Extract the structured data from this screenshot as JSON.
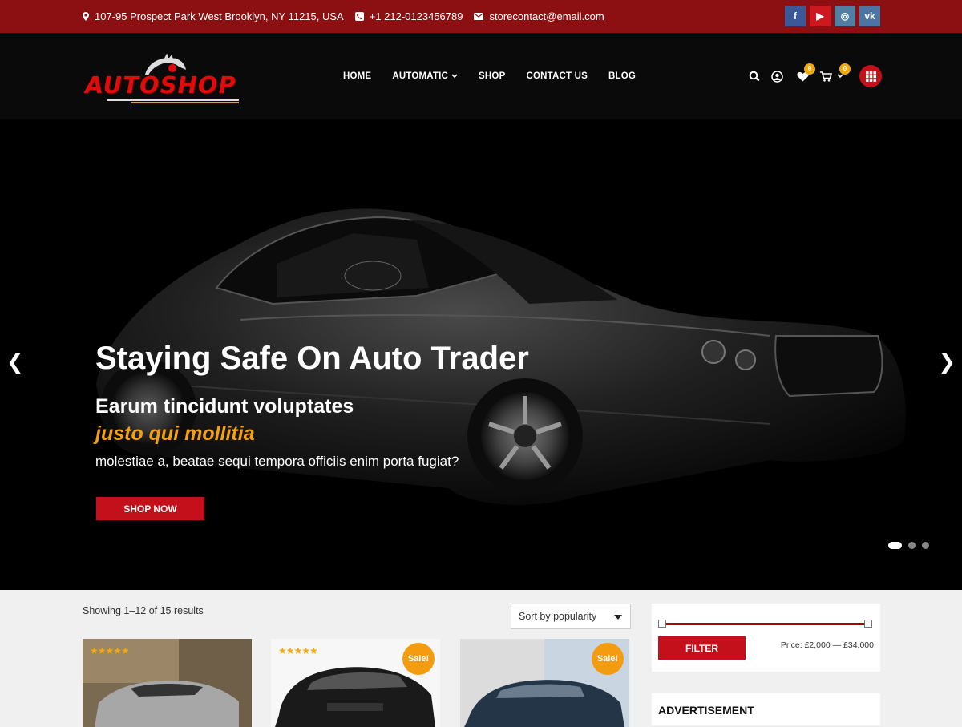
{
  "topbar": {
    "address": "107-95 Prospect Park West Brooklyn, NY 11215, USA",
    "phone": "+1 212-0123456789",
    "email": "storecontact@email.com",
    "social": [
      {
        "name": "facebook-icon",
        "glyph": "f"
      },
      {
        "name": "youtube-icon",
        "glyph": "▶"
      },
      {
        "name": "instagram-icon",
        "glyph": "◎"
      },
      {
        "name": "vk-icon",
        "glyph": "vk"
      }
    ]
  },
  "header": {
    "logo_text": "AUTOSHOP",
    "nav": [
      {
        "label": "HOME",
        "dropdown": false
      },
      {
        "label": "AUTOMATIC",
        "dropdown": true
      },
      {
        "label": "SHOP",
        "dropdown": false
      },
      {
        "label": "CONTACT US",
        "dropdown": false
      },
      {
        "label": "BLOG",
        "dropdown": false
      }
    ],
    "wishlist_count": "0",
    "cart_count": "0"
  },
  "hero": {
    "prev_arrow": "❮",
    "next_arrow": "❯",
    "title": "Staying Safe On Auto Trader",
    "subtitle_line1": "Earum tincidunt voluptates",
    "subtitle_line2": "justo qui mollitia",
    "description": "molestiae a, beatae sequi tempora officiis enim porta fugiat?",
    "button": "SHOP NOW",
    "slides_total": 3,
    "active_slide": 1
  },
  "shop": {
    "showing": "Showing 1–12 of 15 results",
    "sort_selected": "Sort by popularity",
    "products": [
      {
        "stars": "★★★★★",
        "sale": ""
      },
      {
        "stars": "★★★★★",
        "sale": "Sale!"
      },
      {
        "stars": "",
        "sale": "Sale!"
      }
    ]
  },
  "sidebar": {
    "filter_button": "FILTER",
    "price_label": "Price: £2,000 — £34,000",
    "advertisement_title": "ADVERTISEMENT"
  },
  "colors": {
    "topbar": "#8c0f12",
    "accent_red": "#c4101a",
    "accent_orange": "#f5a00d"
  }
}
